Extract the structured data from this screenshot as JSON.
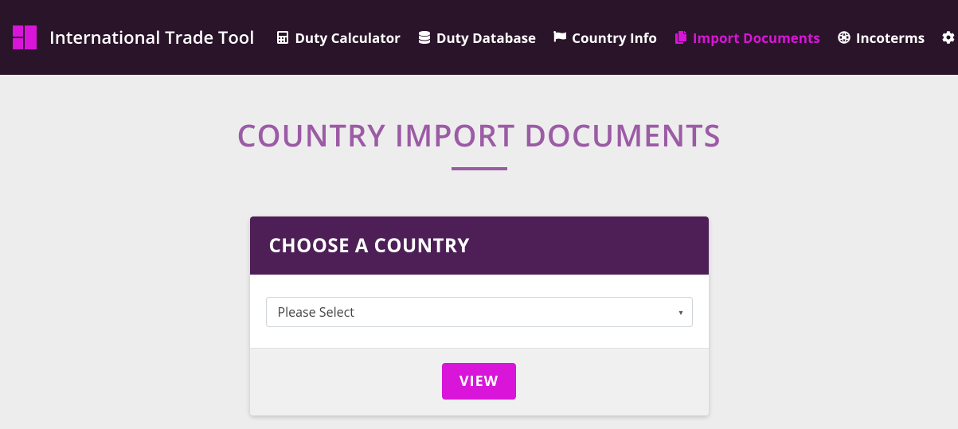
{
  "brand": "International Trade Tool",
  "nav": {
    "duty_calculator": "Duty Calculator",
    "duty_database": "Duty Database",
    "country_info": "Country Info",
    "import_documents": "Import Documents",
    "incoterms": "Incoterms"
  },
  "page": {
    "title": "COUNTRY IMPORT DOCUMENTS"
  },
  "card": {
    "header": "CHOOSE A COUNTRY",
    "select_placeholder": "Please Select",
    "button": "VIEW"
  }
}
